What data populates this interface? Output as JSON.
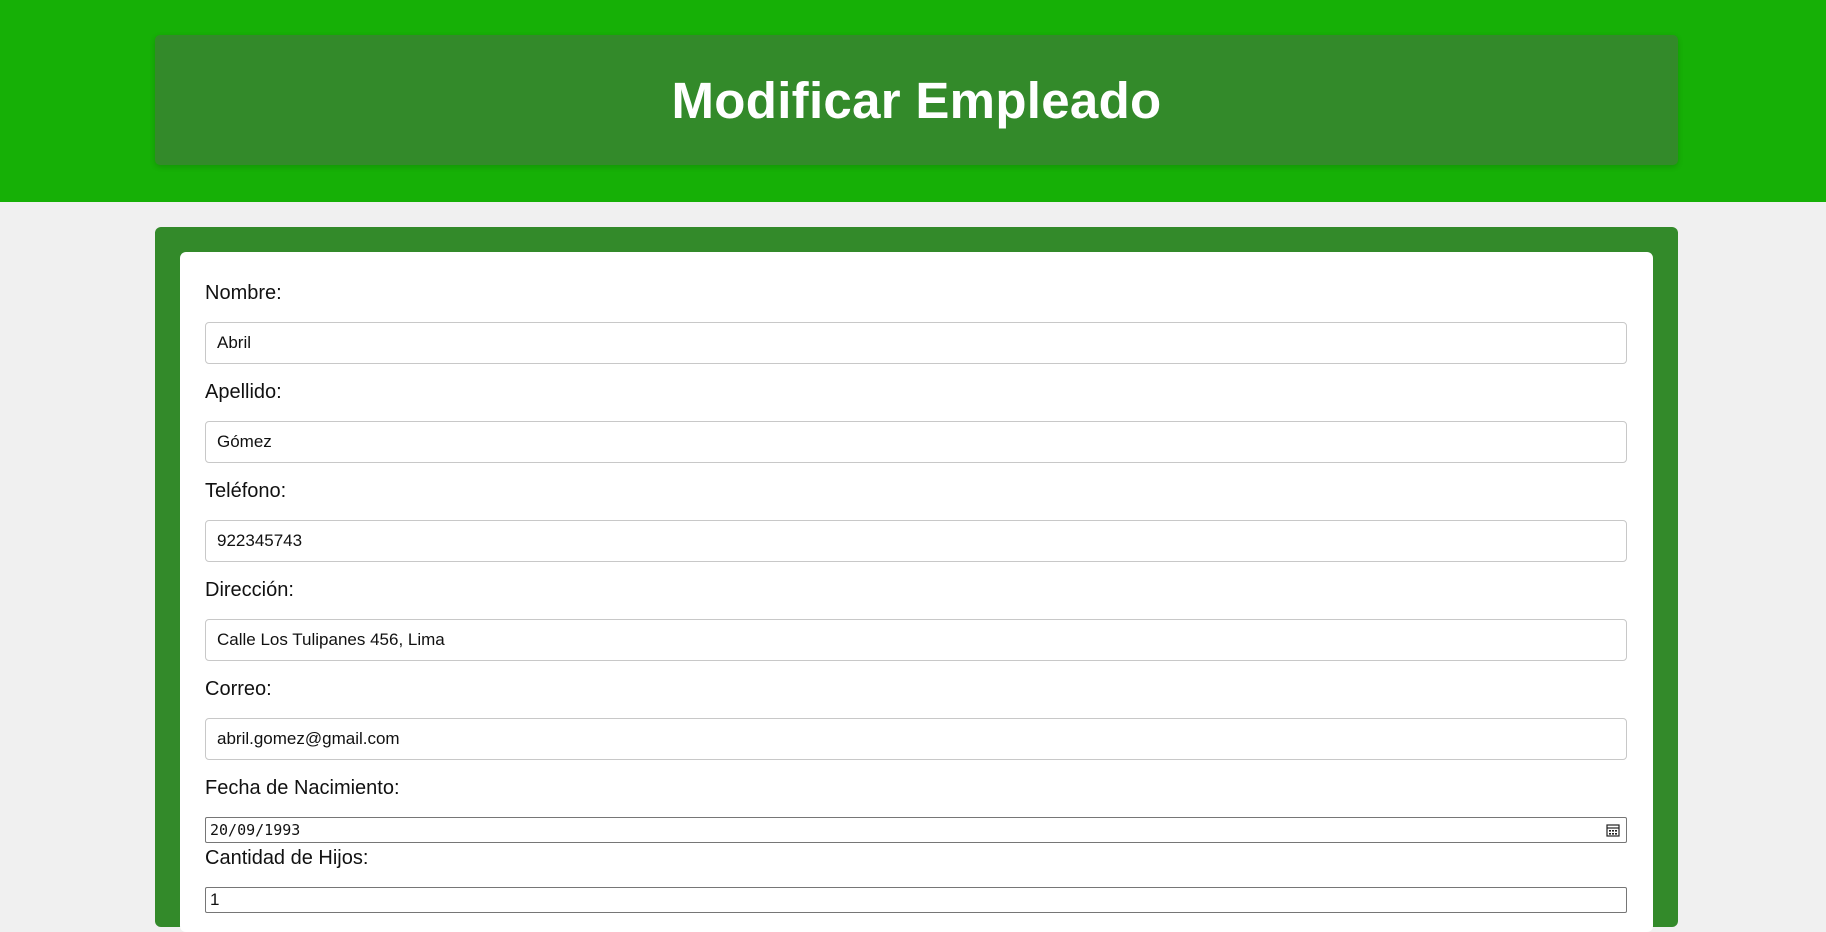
{
  "header": {
    "title": "Modificar Empleado"
  },
  "form": {
    "fields": [
      {
        "label": "Nombre:",
        "value": "Abril"
      },
      {
        "label": "Apellido:",
        "value": "Gómez"
      },
      {
        "label": "Teléfono:",
        "value": "922345743"
      },
      {
        "label": "Dirección:",
        "value": "Calle Los Tulipanes 456, Lima"
      },
      {
        "label": "Correo:",
        "value": "abril.gomez@gmail.com"
      },
      {
        "label": "Fecha de Nacimiento:",
        "value": "20/09/1993"
      },
      {
        "label": "Cantidad de Hijos:",
        "value": "1"
      }
    ]
  },
  "colors": {
    "top_band": "#16b006",
    "header_card": "#338a2a",
    "form_frame": "#338a2a",
    "page_background": "#f0f0f0"
  },
  "icons": {
    "date_picker": "calendar-icon"
  }
}
